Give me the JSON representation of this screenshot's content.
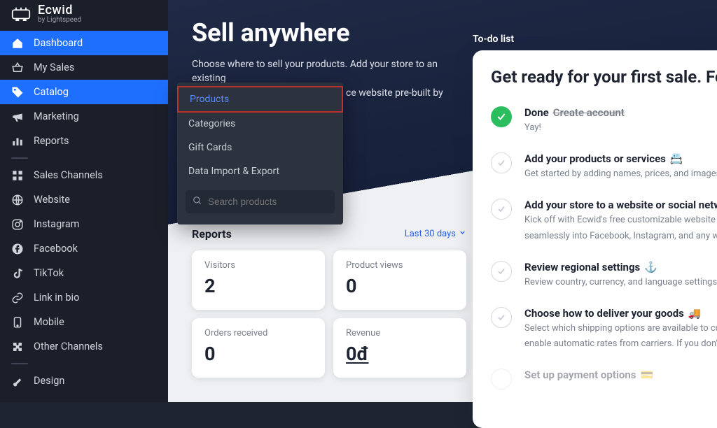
{
  "brand": {
    "name": "Ecwid",
    "sub": "by Lightspeed"
  },
  "sidebar": {
    "items": [
      {
        "label": "Dashboard"
      },
      {
        "label": "My Sales"
      },
      {
        "label": "Catalog"
      },
      {
        "label": "Marketing"
      },
      {
        "label": "Reports"
      },
      {
        "label": "Sales Channels"
      },
      {
        "label": "Website"
      },
      {
        "label": "Instagram"
      },
      {
        "label": "Facebook"
      },
      {
        "label": "TikTok"
      },
      {
        "label": "Link in bio"
      },
      {
        "label": "Mobile"
      },
      {
        "label": "Other Channels"
      },
      {
        "label": "Design"
      }
    ]
  },
  "submenu": {
    "items": [
      {
        "label": "Products"
      },
      {
        "label": "Categories"
      },
      {
        "label": "Gift Cards"
      },
      {
        "label": "Data Import & Export"
      }
    ],
    "search_placeholder": "Search products"
  },
  "hero": {
    "title": "Sell anywhere",
    "line1": "Choose where to sell your products. Add your store to an existing",
    "line2": "ce website pre-built by"
  },
  "todo": {
    "label": "To-do list",
    "heading": "Get ready for your first sale. Follow",
    "items": [
      {
        "title": "Done",
        "extra": "Create account",
        "desc": "Yay!"
      },
      {
        "title": "Add your products or services",
        "emoji": "📇",
        "desc": "Get started by adding names, prices, and images. Es"
      },
      {
        "title": "Add your store to a website or social network",
        "desc1": "Kick off with Ecwid's free customizable website or a",
        "desc2": "seamlessly into Facebook, Instagram, and any webs"
      },
      {
        "title": "Review regional settings",
        "emoji": "⚓",
        "desc": "Review country, currency, and language settings of"
      },
      {
        "title": "Choose how to deliver your goods",
        "emoji": "🚚",
        "desc1": "Select which shipping options are available to custo",
        "desc2": "enable automatic rates from carriers. If you don't se"
      },
      {
        "title": "Set up payment options",
        "emoji": "💳"
      }
    ]
  },
  "reports": {
    "heading": "Reports",
    "range": "Last 30 days",
    "cards": [
      {
        "label": "Visitors",
        "value": "2"
      },
      {
        "label": "Product views",
        "value": "0"
      },
      {
        "label": "Orders received",
        "value": "0"
      },
      {
        "label": "Revenue",
        "value": "0đ"
      }
    ]
  }
}
